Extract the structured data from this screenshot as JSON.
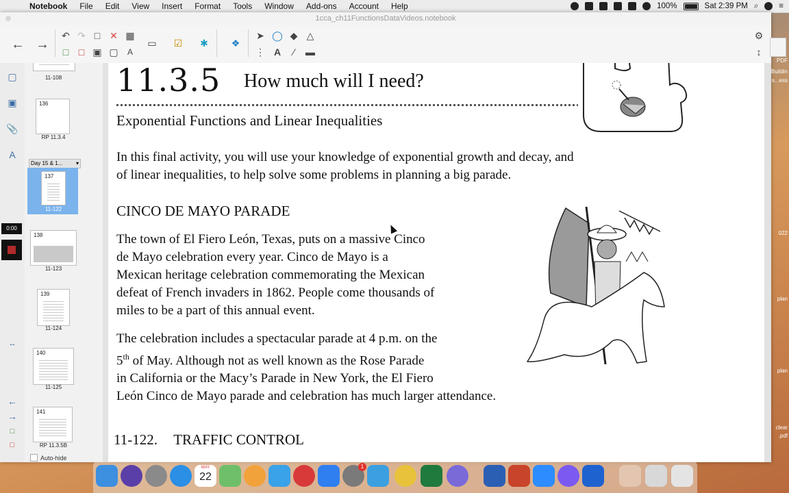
{
  "menubar": {
    "items": [
      "Notebook",
      "File",
      "Edit",
      "View",
      "Insert",
      "Format",
      "Tools",
      "Window",
      "Add-ons",
      "Account",
      "Help"
    ],
    "battery": "100%",
    "clock": "Sat 2:39 PM"
  },
  "window": {
    "title": "1cca_ch11FunctionsDataVideos.notebook"
  },
  "sorter": {
    "thumbs": [
      {
        "num": "",
        "label": "11-108"
      },
      {
        "num": "136",
        "label": "RP 11.3.4"
      },
      {
        "num": "137",
        "label": "11-122"
      },
      {
        "num": "138",
        "label": "11-123"
      },
      {
        "num": "139",
        "label": "11-124"
      },
      {
        "num": "140",
        "label": "11-125"
      },
      {
        "num": "141",
        "label": "RP 11.3.5B"
      }
    ],
    "group_label": "Day 15 & 1...",
    "autohide_label": "Auto-hide",
    "timer": "0:00"
  },
  "page": {
    "lesson_number": "11.3.5",
    "lesson_title": "How much will I need?",
    "subtitle": "Exponential Functions and Linear Inequalities",
    "intro_line1": "In this final activity, you will use your knowledge of exponential growth and decay, and",
    "intro_line2": "of linear inequalities, to help solve some problems in planning a big parade.",
    "section_heading": "CINCO DE MAYO PARADE",
    "p1_lines": [
      "The town of El Fiero León, Texas, puts on a massive Cinco",
      "de Mayo celebration every year.  Cinco de Mayo is a",
      "Mexican heritage celebration commemorating the Mexican",
      "defeat of French invaders in 1862.  People come thousands of",
      "miles to be a part of this annual event."
    ],
    "p2_line1": "The celebration includes a spectacular parade at 4 p.m. on the",
    "p2_line2_a": "5",
    "p2_line2_sup": "th",
    "p2_line2_b": " of May.  Although not as well known as the Rose Parade",
    "p2_line3": "in California or the Macy’s Parade in New York, the El Fiero",
    "p2_line4": "León Cinco de Mayo parade and celebration has much larger attendance.",
    "problem_number": "11-122.",
    "problem_title": "TRAFFIC CONTROL"
  },
  "desktop": {
    "labels": [
      "PDF",
      "Buildin",
      "s...ess",
      "022",
      "plan",
      "plan",
      "clear",
      ".pdf"
    ]
  },
  "dock": {
    "calendar_month": "MAY",
    "calendar_day": "22",
    "badge_count": "1"
  }
}
